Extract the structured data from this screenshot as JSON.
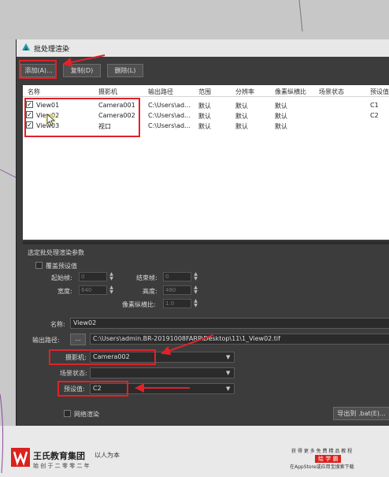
{
  "window": {
    "title": "批处理渲染"
  },
  "toolbar": {
    "add": "添加(A)...",
    "copy": "复制(D)",
    "delete": "删除(L)"
  },
  "table": {
    "headers": [
      "名称",
      "摄影机",
      "输出路径",
      "范围",
      "分辨率",
      "像素纵横比",
      "场景状态",
      "预设值"
    ],
    "rows": [
      {
        "name": "View01",
        "camera": "Camera001",
        "path": "C:\\Users\\ad...",
        "range": "默认",
        "res": "默认",
        "aspect": "默认",
        "state": "",
        "preset": "C1",
        "checked": true
      },
      {
        "name": "View02",
        "camera": "Camera002",
        "path": "C:\\Users\\ad...",
        "range": "默认",
        "res": "默认",
        "aspect": "默认",
        "state": "",
        "preset": "C2",
        "checked": true
      },
      {
        "name": "View03",
        "camera": "视口",
        "path": "C:\\Users\\ad...",
        "range": "默认",
        "res": "默认",
        "aspect": "默认",
        "state": "",
        "preset": "",
        "checked": true
      }
    ]
  },
  "params": {
    "group_title": "选定批处理渲染参数",
    "override_label": "覆盖预设值",
    "start_frame_label": "起始帧:",
    "start_frame_value": "0",
    "end_frame_label": "结束帧:",
    "end_frame_value": "0",
    "width_label": "宽度:",
    "width_value": "640",
    "height_label": "高度:",
    "height_value": "480",
    "aspect_label": "像素纵横比:",
    "aspect_value": "1.0",
    "name_label": "名称:",
    "name_value": "View02",
    "output_label": "输出路径:",
    "browse": "...",
    "output_value": "C:\\Users\\admin.BR-20191008FARP\\Desktop\\11\\1_View02.tif",
    "camera_label": "摄影机:",
    "camera_value": "Camera002",
    "scene_state_label": "场景状态:",
    "scene_state_value": "",
    "preset_label": "预设值:",
    "preset_value": "C2"
  },
  "footer": {
    "net_render": "网络渲染",
    "export": "导出到 .bat(E)..."
  },
  "watermark": {
    "brand": "王氏教育集团",
    "slogan": "以人为本",
    "sub": "始 创 于 二 零 零 二 年",
    "right1": "获 得 更 多 免 费 精 品 教 程",
    "right2": "绘 学 霸",
    "right3": "在AppStore或应用宝搜索下载"
  },
  "colors": {
    "accent_red": "#e0222a",
    "window_bg": "#3c3c3c"
  }
}
